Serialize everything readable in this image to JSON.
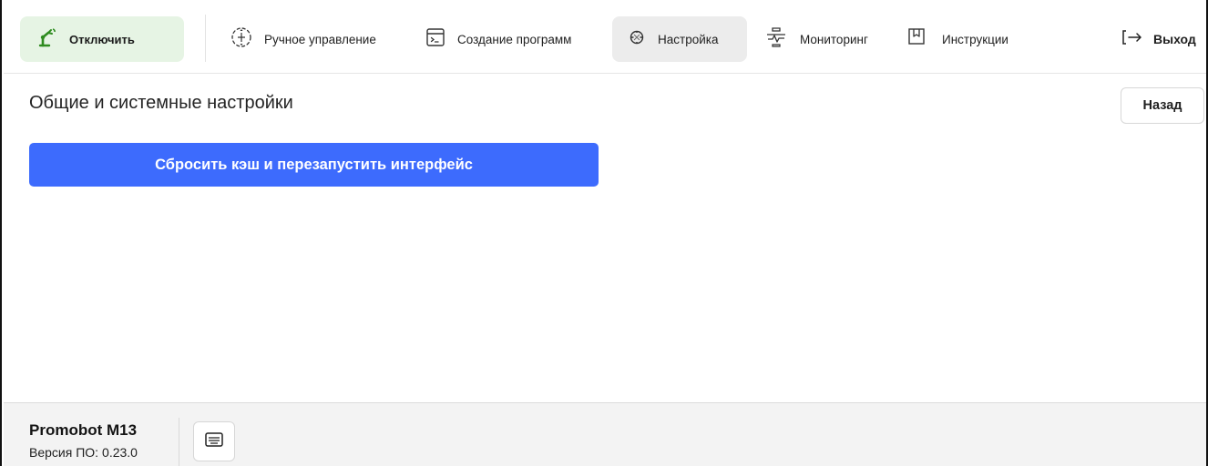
{
  "topbar": {
    "disable_button": {
      "label": "Отключить",
      "icon": "robot-arm-icon",
      "accent": "#e6f4e4",
      "icon_color": "#2e8b1f"
    },
    "nav": [
      {
        "label": "Ручное управление",
        "icon": "manual-control-icon"
      },
      {
        "label": "Создание программ",
        "icon": "terminal-program-icon"
      },
      {
        "label": "Настройка",
        "icon": "settings-gear-icon",
        "active": true
      },
      {
        "label": "Мониторинг",
        "icon": "monitoring-icon"
      },
      {
        "label": "Инструкции",
        "icon": "bookmark-icon"
      }
    ],
    "logout": {
      "label": "Выход",
      "icon": "logout-arrow-icon"
    }
  },
  "main": {
    "title": "Общие и системные настройки",
    "back_button": "Назад",
    "reset_button": "Сбросить кэш и перезапустить интерфейс",
    "reset_color": "#3d6bfd"
  },
  "footer": {
    "product": "Promobot M13",
    "version_label": "Версия ПО:",
    "version_value": "0.23.0",
    "keyboard_icon": "keyboard-icon"
  }
}
